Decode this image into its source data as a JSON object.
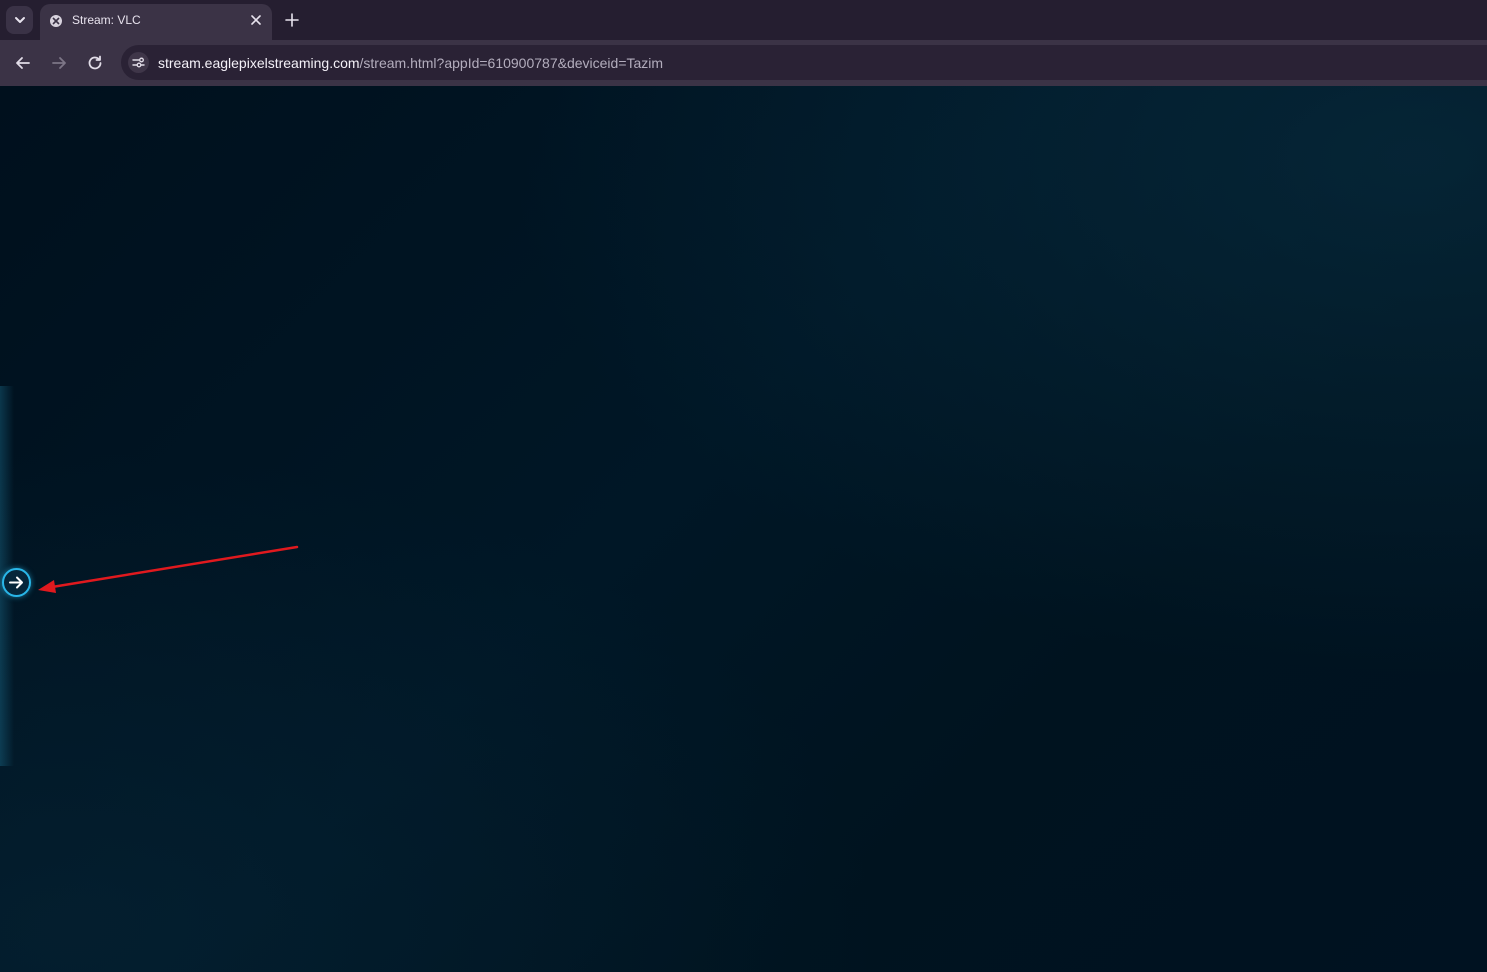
{
  "browser": {
    "tab": {
      "title": "Stream: VLC",
      "favicon": "globe-icon"
    },
    "tab_search_icon": "chevron-down-icon",
    "new_tab_icon": "plus-icon",
    "nav": {
      "back_icon": "arrow-left-icon",
      "forward_icon": "arrow-right-icon",
      "reload_icon": "reload-icon"
    },
    "address_bar": {
      "site_info_icon": "tune-icon",
      "url_host": "stream.eaglepixelstreaming.com",
      "url_path": "/stream.html?appId=610900787&deviceid=Tazim"
    }
  },
  "page": {
    "expand_button_icon": "arrow-right-circle-icon",
    "annotation": {
      "type": "arrow",
      "color": "#e0191e"
    }
  },
  "colors": {
    "tab_strip": "#251e30",
    "toolbar": "#3b3346",
    "page_background": "#001726",
    "accent": "#29b6e8"
  }
}
